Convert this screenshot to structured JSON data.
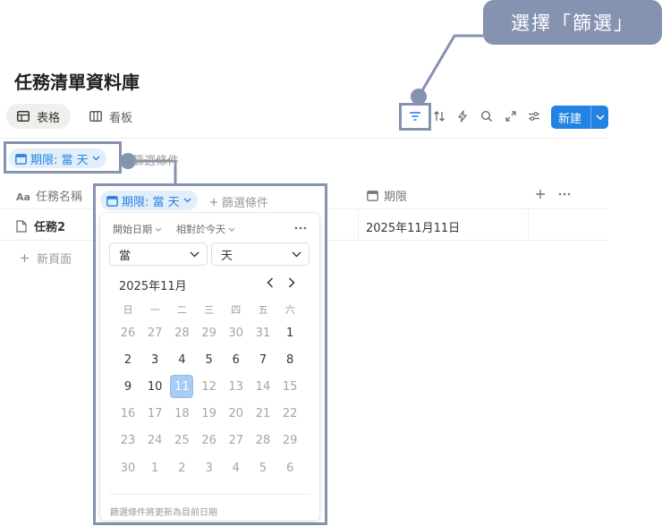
{
  "callout": {
    "text": "選擇「篩選」"
  },
  "database": {
    "title": "任務清單資料庫"
  },
  "views": {
    "table": "表格",
    "board": "看板"
  },
  "toolbar": {
    "new_label": "新建"
  },
  "filter_bar": {
    "chip_label": "期限: 當 天",
    "add_filter_label": "篩選條件"
  },
  "table": {
    "columns": {
      "name": "任務名稱",
      "deadline": "期限"
    },
    "rows": [
      {
        "name": "任務2",
        "deadline": "2025年11月11日"
      }
    ],
    "new_page_label": "新頁面"
  },
  "popup": {
    "chip_label": "期限: 當 天",
    "add_filter_label": "篩選條件",
    "option_start": "開始日期",
    "option_relative": "相對於今天",
    "select_when": "當",
    "select_unit": "天",
    "month_label": "2025年11月",
    "weekdays": [
      "日",
      "一",
      "二",
      "三",
      "四",
      "五",
      "六"
    ],
    "weeks": [
      [
        "26",
        "27",
        "28",
        "29",
        "30",
        "31",
        "1"
      ],
      [
        "2",
        "3",
        "4",
        "5",
        "6",
        "7",
        "8"
      ],
      [
        "9",
        "10",
        "11",
        "12",
        "13",
        "14",
        "15"
      ],
      [
        "16",
        "17",
        "18",
        "19",
        "20",
        "21",
        "22"
      ],
      [
        "23",
        "24",
        "25",
        "26",
        "27",
        "28",
        "29"
      ],
      [
        "30",
        "1",
        "2",
        "3",
        "4",
        "5",
        "6"
      ]
    ],
    "footer_note": "篩選條件將更新為目前日期"
  },
  "colors": {
    "accent": "#2383e2",
    "callout": "#8592b0",
    "today": "#a8ccf2"
  }
}
